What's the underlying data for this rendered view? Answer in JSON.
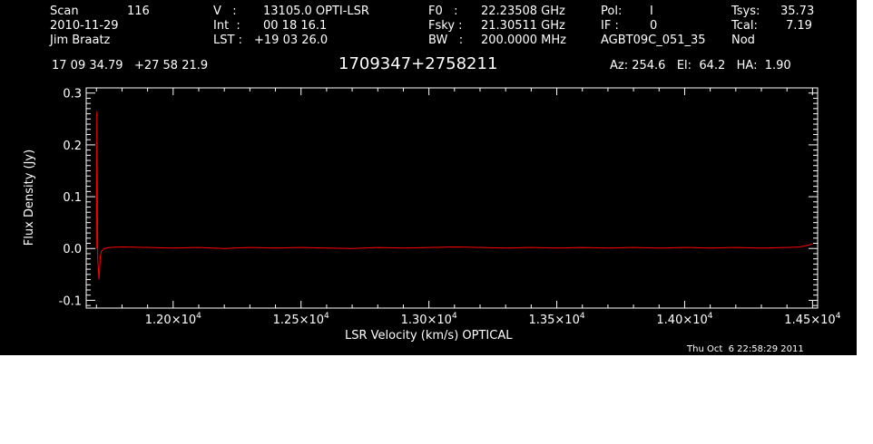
{
  "header": {
    "row1": [
      {
        "label": "Scan",
        "value": "116"
      },
      {
        "label": "V   :",
        "value": "13105.0 OPTI-LSR"
      },
      {
        "label": "F0   :",
        "value": "22.23508 GHz"
      },
      {
        "label": "Pol:",
        "value": "I"
      },
      {
        "label": "Tsys:",
        "value": "35.73"
      }
    ],
    "row2": [
      {
        "label": "2010-11-29",
        "value": ""
      },
      {
        "label": "Int  :",
        "value": "00 18 16.1"
      },
      {
        "label": "Fsky :",
        "value": "21.30511 GHz"
      },
      {
        "label": "IF :",
        "value": "0"
      },
      {
        "label": "Tcal:",
        "value": "7.19"
      }
    ],
    "row3": [
      {
        "label": "Jim Braatz",
        "value": ""
      },
      {
        "label": "LST :",
        "value": "+19 03 26.0"
      },
      {
        "label": "BW   :",
        "value": "200.0000 MHz"
      },
      {
        "label": "AGBT09C_051_35",
        "value": ""
      },
      {
        "label": "Nod",
        "value": ""
      }
    ],
    "coords": "17 09 34.79   +27 58 21.9",
    "source": "1709347+2758211",
    "pointing": "Az: 254.6   El:  64.2   HA:  1.90"
  },
  "timestamp": "Thu Oct  6 22:58:29 2011",
  "chart_data": {
    "type": "line",
    "xlabel": "LSR Velocity (km/s) OPTICAL",
    "ylabel": "Flux Density (Jy)",
    "xlim": [
      11660,
      14520
    ],
    "ylim": [
      -0.115,
      0.31
    ],
    "xticks": [
      12000,
      12500,
      13000,
      13500,
      14000,
      14500
    ],
    "xtick_labels": [
      {
        "mant": "1.20×10",
        "exp": "4"
      },
      {
        "mant": "1.25×10",
        "exp": "4"
      },
      {
        "mant": "1.30×10",
        "exp": "4"
      },
      {
        "mant": "1.35×10",
        "exp": "4"
      },
      {
        "mant": "1.40×10",
        "exp": "4"
      },
      {
        "mant": "1.45×10",
        "exp": "4"
      }
    ],
    "yticks": [
      -0.1,
      0.0,
      0.1,
      0.2,
      0.3
    ],
    "ytick_labels": [
      "-0.1",
      "0.0",
      "0.1",
      "0.2",
      "0.3"
    ],
    "line_color": "#ff0000",
    "series": [
      {
        "x": [
          11700,
          11702,
          11705,
          11710,
          11715,
          11720,
          11730,
          11750,
          11800,
          11900,
          12000,
          12100,
          12200,
          12300,
          12400,
          12500,
          12600,
          12700,
          12800,
          12900,
          13000,
          13100,
          13200,
          13300,
          13400,
          13500,
          13600,
          13700,
          13800,
          13900,
          14000,
          14100,
          14200,
          14300,
          14400,
          14450,
          14480,
          14500
        ],
        "y": [
          0.0,
          0.265,
          -0.02,
          -0.06,
          -0.015,
          -0.005,
          0.0,
          0.002,
          0.003,
          0.002,
          0.001,
          0.002,
          0.0,
          0.002,
          0.001,
          0.002,
          0.001,
          0.0,
          0.002,
          0.001,
          0.002,
          0.003,
          0.002,
          0.001,
          0.002,
          0.001,
          0.002,
          0.001,
          0.002,
          0.001,
          0.002,
          0.001,
          0.002,
          0.001,
          0.002,
          0.003,
          0.006,
          0.009
        ]
      }
    ]
  }
}
